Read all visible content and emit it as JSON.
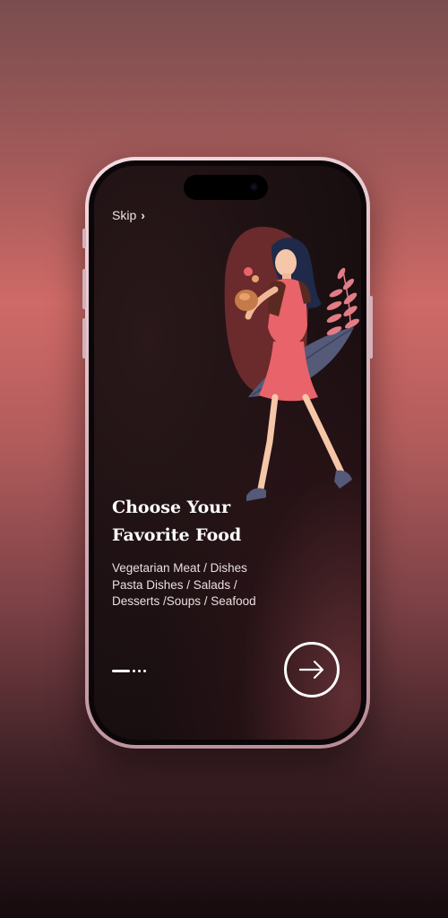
{
  "skip": {
    "label": "Skip",
    "icon": "chevron-right-icon"
  },
  "onboarding": {
    "title_line1": "Choose Your",
    "title_line2": "Favorite Food",
    "subtitle_line1": "Vegetarian Meat / Dishes",
    "subtitle_line2": "Pasta Dishes / Salads /",
    "subtitle_line3": "Desserts /Soups / Seafood"
  },
  "pager": {
    "total": 4,
    "current": 1
  },
  "next_button": {
    "icon": "arrow-right-icon"
  },
  "colors": {
    "accent": "#e8636a",
    "text": "#ffffff",
    "screen_bg": "#1a0f11",
    "blob": "#6b2a2c"
  }
}
